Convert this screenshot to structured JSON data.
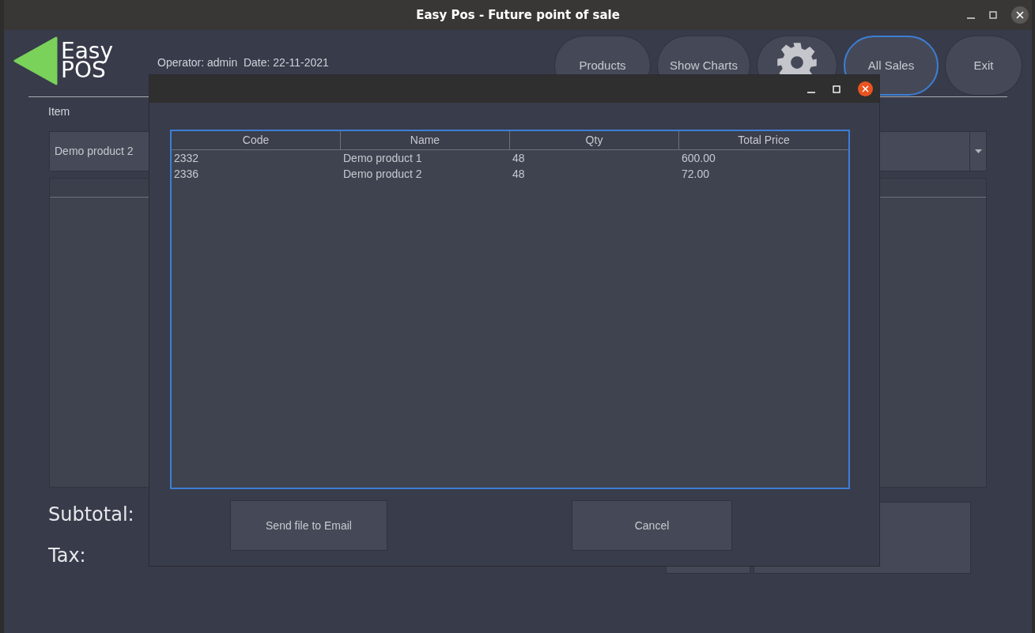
{
  "window": {
    "title": "Easy Pos - Future point of sale"
  },
  "header": {
    "logo_line_1": "Easy",
    "logo_line_2": "POS",
    "operator_info": "Operator: admin  Date: 22-11-2021",
    "nav_buttons": [
      {
        "kind": "text",
        "label": "Products",
        "selected": false
      },
      {
        "kind": "text",
        "label": "Show Charts",
        "selected": false
      },
      {
        "kind": "icon",
        "selected": false
      },
      {
        "kind": "text",
        "label": "All Sales",
        "selected": true
      },
      {
        "kind": "text",
        "label": "Exit",
        "selected": false
      }
    ]
  },
  "item_label": "Item",
  "item_combo": {
    "value": "Demo product 2"
  },
  "subtotal_label": "Subtotal:",
  "tax_label": "Tax:",
  "dialog": {
    "table": {
      "columns": [
        "Code",
        "Name",
        "Qty",
        "Total Price"
      ],
      "rows": [
        [
          "2332",
          "Demo product 1",
          "48",
          "600.00"
        ],
        [
          "2336",
          "Demo product 2",
          "48",
          "72.00"
        ]
      ]
    },
    "buttons": [
      "Send file to Email",
      "Cancel"
    ]
  }
}
